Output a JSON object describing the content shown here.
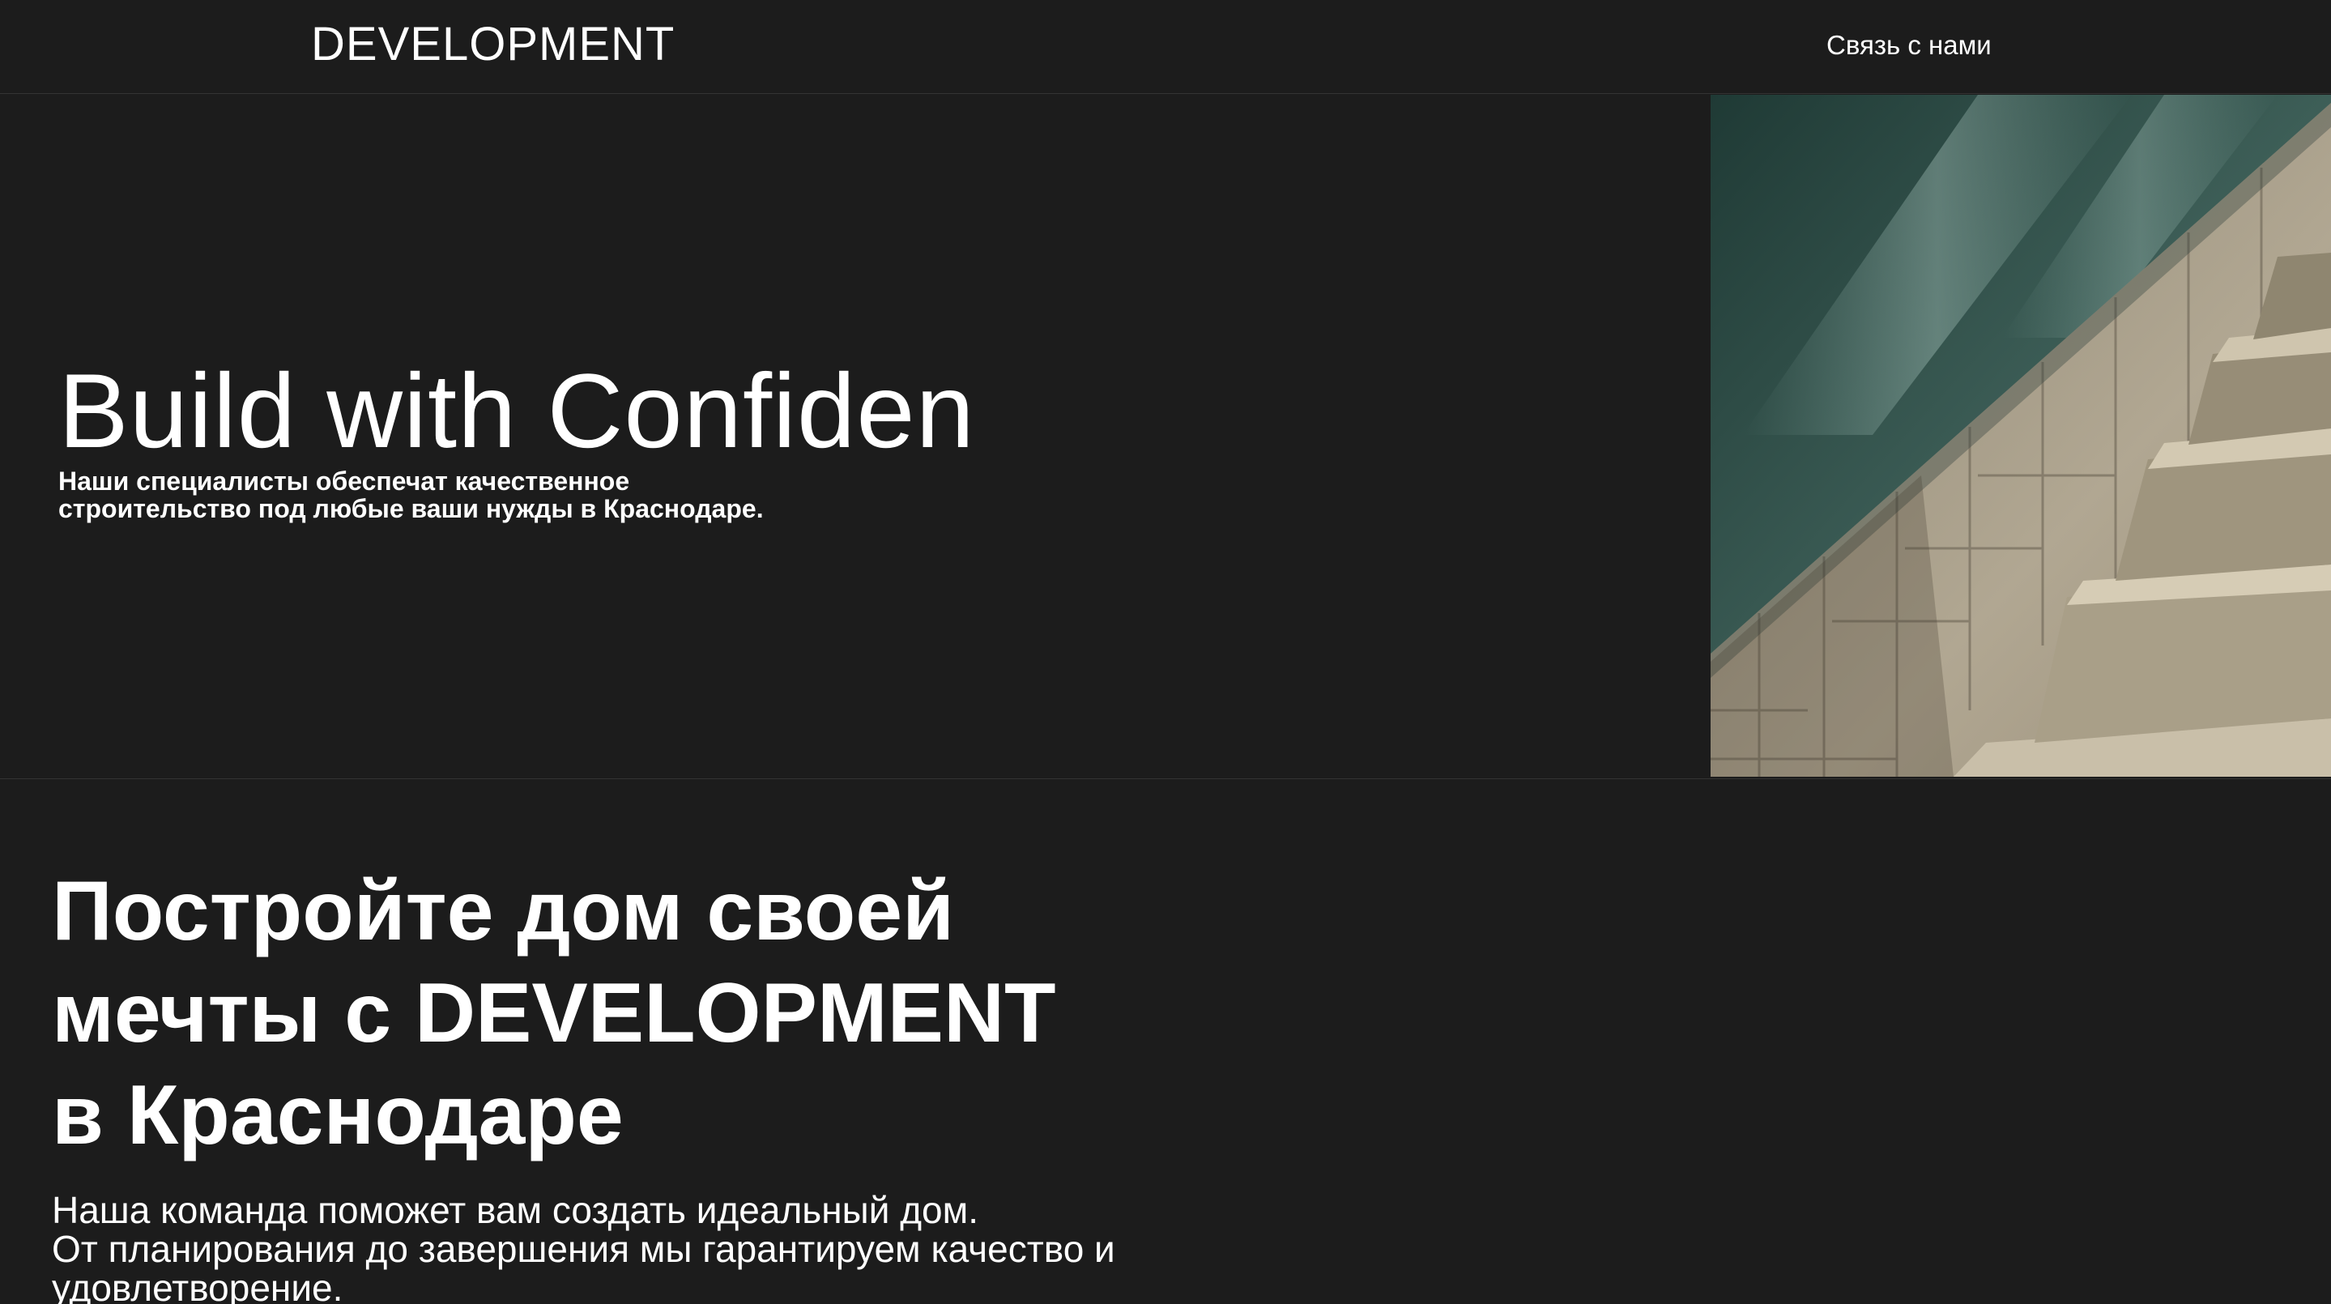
{
  "header": {
    "logo": "DEVELOPMENT",
    "contact_label": "Связь с нами"
  },
  "hero": {
    "title": "Build with Confiden",
    "subtitle_lines": [
      "Наши специалисты обеспечат качественное",
      "строительство под любые ваши нужды в Краснодаре."
    ],
    "image": "stairs-photo"
  },
  "feature": {
    "title_lines": [
      "Постройте дом своей",
      "мечты с DEVELOPMENT",
      "в Краснодаре"
    ],
    "text_lines": [
      "Наша команда поможет вам создать идеальный дом.",
      "От планирования до завершения мы гарантируем качество и",
      "удовлетворение."
    ]
  },
  "colors": {
    "background": "#1c1c1c",
    "text": "#ffffff",
    "divider": "#333333"
  }
}
